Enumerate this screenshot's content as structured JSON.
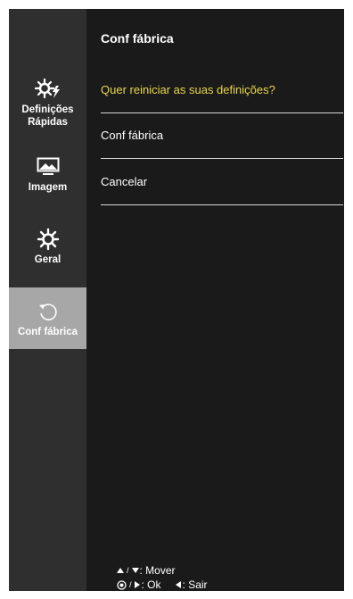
{
  "sidebar": {
    "items": [
      {
        "label_line1": "Definições",
        "label_line2": "Rápidas",
        "icon": "quick-settings-gear-icon"
      },
      {
        "label": "Imagem",
        "icon": "picture-icon"
      },
      {
        "label": "Geral",
        "icon": "gear-icon"
      },
      {
        "label": "Conf fábrica",
        "icon": "reset-icon",
        "active": true
      }
    ]
  },
  "panel": {
    "title": "Conf fábrica",
    "question": "Quer reiniciar as suas definições?",
    "options": [
      "Conf fábrica",
      "Cancelar"
    ]
  },
  "hints": {
    "move_sep": "/",
    "move_label": ": Mover",
    "ok_sep": "/",
    "ok_label": ": Ok",
    "exit_label": ": Sair"
  },
  "colors": {
    "osd_bg": "#1b1a1a",
    "sidebar_bg": "#2f2f2f",
    "active_bg": "#a7a7a7",
    "question_text": "#e6d84a"
  }
}
